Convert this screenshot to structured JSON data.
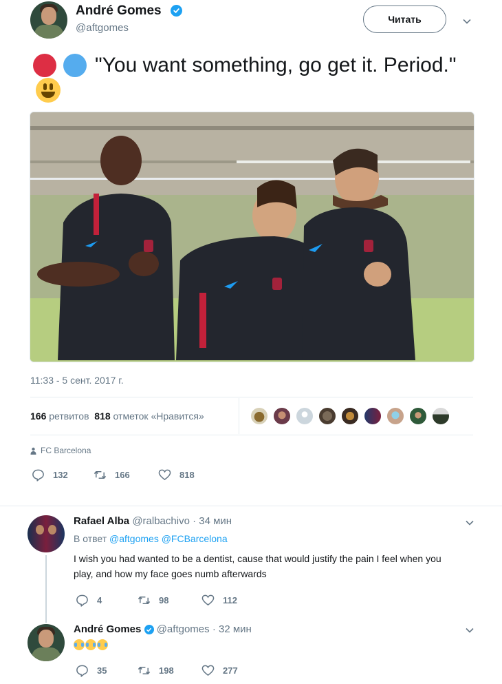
{
  "tweet": {
    "author_name": "André Gomes",
    "author_handle": "@aftgomes",
    "follow_label": "Читать",
    "text": "\"You want something, go get it. Period.\"",
    "timestamp": "11:33 - 5 сент. 2017 г.",
    "retweets_count": "166",
    "retweets_label": "ретвитов",
    "likes_count": "818",
    "likes_label": "отметок «Нравится»",
    "location": "FC Barcelona",
    "actions": {
      "replies": "132",
      "retweets": "166",
      "likes": "818"
    }
  },
  "replies": [
    {
      "author_name": "Rafael Alba",
      "author_handle": "@ralbachivo",
      "time": "· 34 мин",
      "context_prefix": "В ответ",
      "context_mentions": "@aftgomes @FCBarcelona",
      "text": "I wish you had wanted to be a dentist, cause that would justify the pain I feel when you play, and how my face goes numb afterwards",
      "actions": {
        "replies": "4",
        "retweets": "98",
        "likes": "112"
      }
    },
    {
      "author_name": "André Gomes",
      "author_handle": "@aftgomes",
      "time": "· 32 мин",
      "text_emoji": "face-with-tears-of-joy x3",
      "actions": {
        "replies": "35",
        "retweets": "198",
        "likes": "277"
      }
    }
  ],
  "colors": {
    "accent": "#1da1f2",
    "text": "#14171a",
    "secondary": "#657786",
    "divider": "#e6ecf0"
  }
}
